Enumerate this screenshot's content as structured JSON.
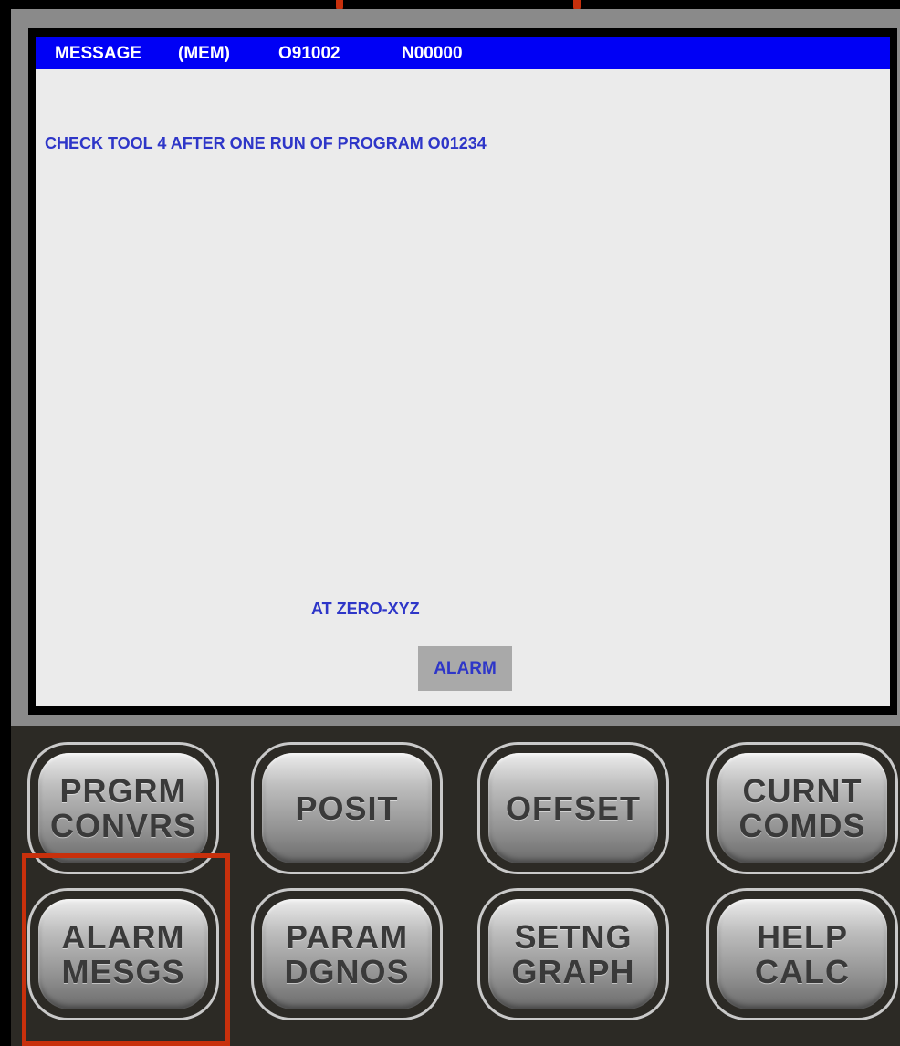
{
  "screen": {
    "status_bar": {
      "screen_name": "MESSAGE",
      "mode": "(MEM)",
      "program_number": "O91002",
      "sequence_number": "N00000"
    },
    "message_text": "CHECK TOOL 4 AFTER ONE RUN OF PROGRAM O01234",
    "position_status": "AT ZERO-XYZ",
    "alarm_indicator": "ALARM"
  },
  "keypad": {
    "row1": [
      {
        "line1": "PRGRM",
        "line2": "CONVRS"
      },
      {
        "line1": "POSIT",
        "line2": ""
      },
      {
        "line1": "OFFSET",
        "line2": ""
      },
      {
        "line1": "CURNT",
        "line2": "COMDS"
      }
    ],
    "row2": [
      {
        "line1": "ALARM",
        "line2": "MESGS"
      },
      {
        "line1": "PARAM",
        "line2": "DGNOS"
      },
      {
        "line1": "SETNG",
        "line2": "GRAPH"
      },
      {
        "line1": "HELP",
        "line2": "CALC"
      }
    ],
    "highlighted_key": "ALARM MESGS"
  },
  "colors": {
    "status_bar_bg": "#0000f5",
    "screen_bg": "#ebebeb",
    "text_blue": "#2e36c8",
    "highlight": "#c8300c"
  }
}
